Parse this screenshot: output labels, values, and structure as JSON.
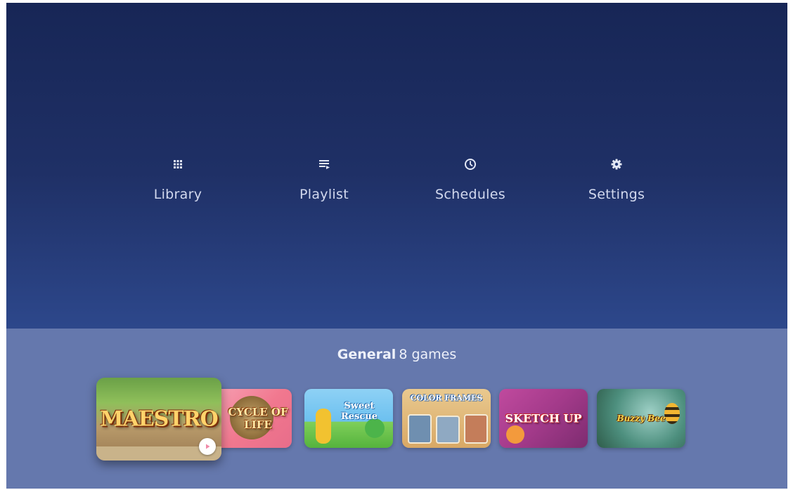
{
  "menu": {
    "items": [
      {
        "label": "Library",
        "icon": "grid-icon"
      },
      {
        "label": "Playlist",
        "icon": "playlist-icon"
      },
      {
        "label": "Schedules",
        "icon": "clock-icon"
      },
      {
        "label": "Settings",
        "icon": "gear-icon"
      }
    ]
  },
  "shelf": {
    "category": "General",
    "count_text": "8 games",
    "games": [
      {
        "name": "MAESTRO",
        "selected": true
      },
      {
        "name": "CYCLE OF LIFE"
      },
      {
        "name": "Sweet Rescue"
      },
      {
        "name": "COLOR FRAMES"
      },
      {
        "name": "SKETCH UP"
      },
      {
        "name": "Buzzy Bee"
      }
    ]
  },
  "colors": {
    "background_top": "#172656",
    "background_bottom": "#3a5ba0",
    "shelf": "#6578ad",
    "text": "#d2d9ee"
  }
}
